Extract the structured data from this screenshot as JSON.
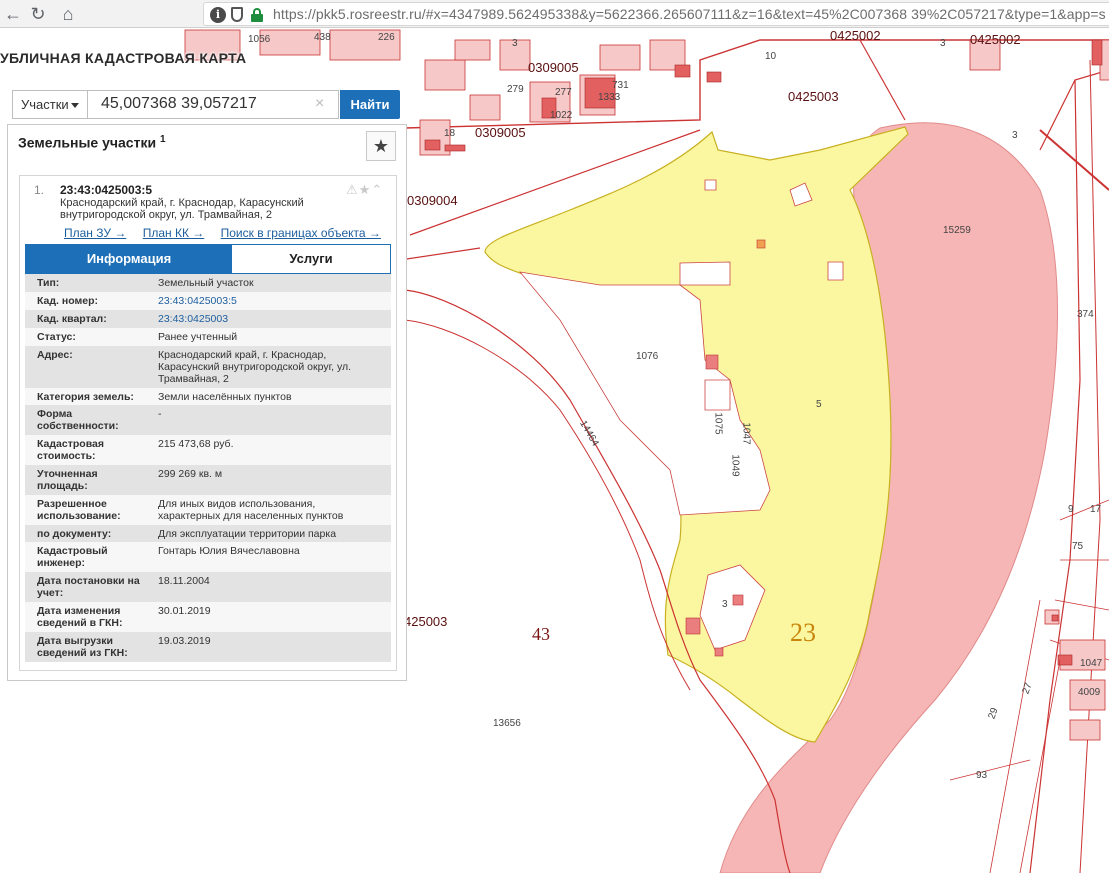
{
  "browser": {
    "url": "https://pkk5.rosreestr.ru/#x=4347989.562495338&y=5622366.265607111&z=16&text=45%2C007368 39%2C057217&type=1&app=s"
  },
  "app": {
    "title": "УБЛИЧНАЯ КАДАСТРОВАЯ КАРТА"
  },
  "search": {
    "type_label": "Участки",
    "query": "45,007368 39,057217",
    "clear_glyph": "×",
    "button_label": "Найти"
  },
  "panel": {
    "title": "Земельные участки",
    "count": "1",
    "result": {
      "index": "1.",
      "cadastral_id": "23:43:0425003:5",
      "address": "Краснодарский край, г. Краснодар, Карасунский внутригородской округ, ул. Трамвайная, 2",
      "links": [
        "План ЗУ →",
        "План КК →",
        "Поиск в границах объекта →"
      ],
      "tabs": [
        "Информация",
        "Услуги"
      ],
      "rows": [
        {
          "key": "Тип:",
          "value": "Земельный участок"
        },
        {
          "key": "Кад. номер:",
          "value": "23:43:0425003:5"
        },
        {
          "key": "Кад. квартал:",
          "value": "23:43:0425003"
        },
        {
          "key": "Статус:",
          "value": "Ранее учтенный"
        },
        {
          "key": "Адрес:",
          "value": "Краснодарский край, г. Краснодар, Карасунский внутригородской округ, ул. Трамвайная, 2"
        },
        {
          "key": "Категория земель:",
          "value": "Земли населённых пунктов"
        },
        {
          "key": "Форма собственности:",
          "value": "-"
        },
        {
          "key": "Кадастровая стоимость:",
          "value": "215 473,68 руб."
        },
        {
          "key": "Уточненная площадь:",
          "value": "299 269 кв. м"
        },
        {
          "key": "Разрешенное использование:",
          "value": "Для иных видов использования, характерных для населенных пунктов"
        },
        {
          "key": "по документу:",
          "value": "Для эксплуатации территории парка"
        },
        {
          "key": "Кадастровый инженер:",
          "value": "Гонтарь Юлия Вячеславовна"
        },
        {
          "key": "Дата постановки на учет:",
          "value": "18.11.2004"
        },
        {
          "key": "Дата изменения сведений в ГКН:",
          "value": "30.01.2019"
        },
        {
          "key": "Дата выгрузки сведений из ГКН:",
          "value": "19.03.2019"
        }
      ]
    }
  },
  "map": {
    "labels": {
      "q0309005a": "0309005",
      "q0309005b": "0309005",
      "q0309004": "0309004",
      "q0425003": "0425003",
      "q0425002a": "0425002",
      "q0425002b": "0425002",
      "q0425003b": "425003",
      "n438": "438",
      "n226": "226",
      "n3a": "3",
      "n10": "10",
      "n731": "731",
      "n1333": "1333",
      "n1022": "1022",
      "n277": "277",
      "n279": "279",
      "n18": "18",
      "n1056": "1056",
      "n15259": "15259",
      "n374": "374",
      "n1076": "1076",
      "n5": "5",
      "n1075": "1075",
      "n1047": "1047",
      "n1049": "1049",
      "n14464": "14464",
      "n43": "43",
      "n23": "23",
      "n3b": "3",
      "n13656": "13656",
      "n75": "75",
      "n9": "9",
      "n17": "17",
      "n3c": "3",
      "n1047b": "1047",
      "n4009": "4009",
      "n27": "27",
      "n29": "29",
      "n93": "93",
      "n3d": "3"
    }
  }
}
